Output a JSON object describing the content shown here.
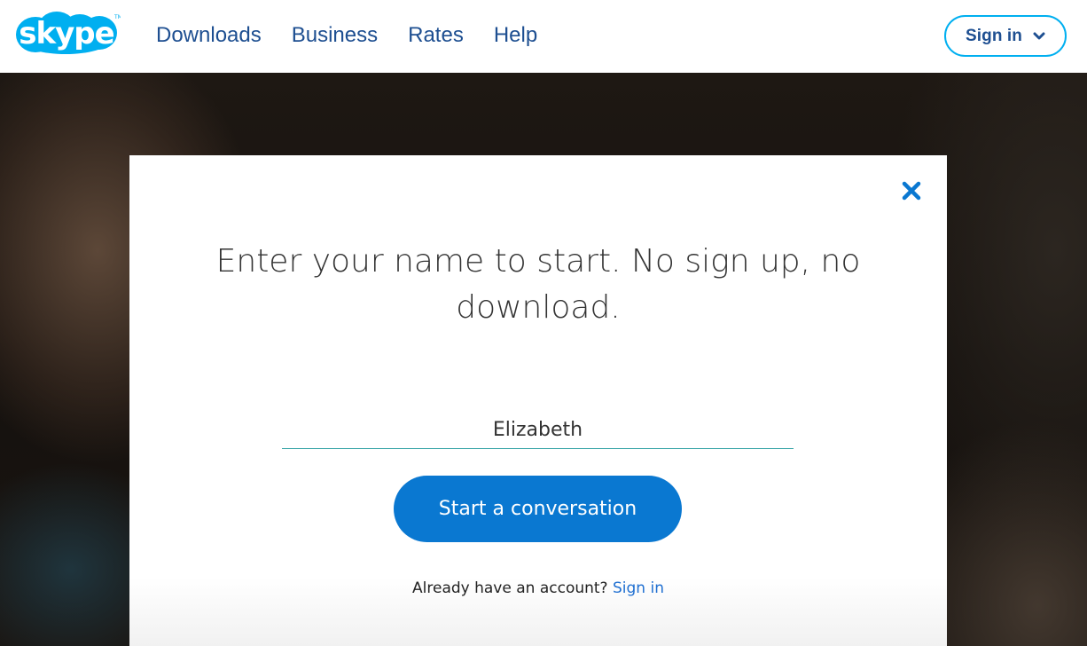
{
  "header": {
    "logo_text": "skype",
    "nav": [
      {
        "label": "Downloads"
      },
      {
        "label": "Business"
      },
      {
        "label": "Rates"
      },
      {
        "label": "Help"
      }
    ],
    "signin_label": "Sign in"
  },
  "modal": {
    "heading": "Enter your name to start. No sign up, no download.",
    "name_value": "Elizabeth",
    "start_button_label": "Start a conversation",
    "account_prompt": "Already have an account?",
    "account_signin_link": "Sign in"
  },
  "colors": {
    "brand_blue": "#00aff0",
    "nav_text": "#1e4f91",
    "button_blue": "#0a78d1",
    "close_icon": "#0a78d1",
    "input_underline": "#3aa6a8"
  },
  "icons": {
    "logo": "skype-logo",
    "close": "close-icon",
    "chevron": "chevron-down-icon"
  }
}
